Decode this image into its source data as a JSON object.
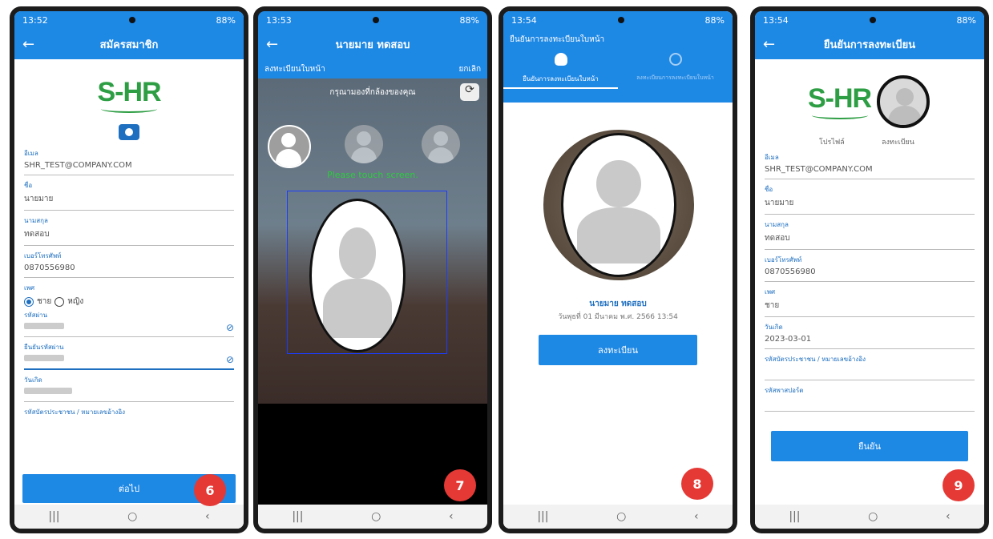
{
  "screens": [
    {
      "status_time": "13:52",
      "status_right": "88%",
      "appbar_title": "สมัครสมาชิก",
      "logo_text": "S-HR",
      "fields": [
        {
          "label": "อีเมล",
          "value": "SHR_TEST@COMPANY.COM"
        },
        {
          "label": "ชื่อ",
          "value": "นายมาย"
        },
        {
          "label": "นามสกุล",
          "value": "ทดสอบ"
        },
        {
          "label": "เบอร์โทรศัพท์",
          "value": "0870556980"
        }
      ],
      "gender_label": "เพศ",
      "gender_options": [
        "ชาย",
        "หญิง"
      ],
      "password_label": "รหัสผ่าน",
      "confirm_password_label": "ยืนยันรหัสผ่าน",
      "birthdate_label": "วันเกิด",
      "id_card_label": "รหัสบัตรประชาชน / หมายเลขอ้างอิง",
      "next_button": "ต่อไป",
      "badge": "6"
    },
    {
      "status_time": "13:53",
      "status_right": "88%",
      "appbar_title": "นายมาย ทดสอบ",
      "subbar_left": "ลงทะเบียนใบหน้า",
      "subbar_right": "ยกเลิก",
      "instruction": "กรุณามองที่กล้องของคุณ",
      "touch_text": "Please touch screen.",
      "badge": "7"
    },
    {
      "status_time": "13:54",
      "status_right": "88%",
      "appbar_title": "ยืนยันการลงทะเบียนใบหน้า",
      "tab_active": "ยืนยันการลงทะเบียนใบหน้า",
      "tab_inactive": "ลงทะเบียนการลงทะเบียนใบหน้า",
      "name": "นายมาย ทดสอบ",
      "date": "วันพุธที่ 01 มีนาคม พ.ศ. 2566 13:54",
      "register_button": "ลงทะเบียน",
      "badge": "8"
    },
    {
      "status_time": "13:54",
      "status_right": "88%",
      "appbar_title": "ยืนยันการลงทะเบียน",
      "logo_text": "S-HR",
      "caption_profile": "โปรไฟล์",
      "caption_register": "ลงทะเบียน",
      "fields": [
        {
          "label": "อีเมล",
          "value": "SHR_TEST@COMPANY.COM"
        },
        {
          "label": "ชื่อ",
          "value": "นายมาย"
        },
        {
          "label": "นามสกุล",
          "value": "ทดสอบ"
        },
        {
          "label": "เบอร์โทรศัพท์",
          "value": "0870556980"
        },
        {
          "label": "เพศ",
          "value": "ชาย"
        },
        {
          "label": "วันเกิด",
          "value": "2023-03-01"
        },
        {
          "label": "รหัสบัตรประชาชน / หมายเลขอ้างอิง",
          "value": ""
        },
        {
          "label": "รหัสพาสปอร์ต",
          "value": ""
        }
      ],
      "confirm_button": "ยืนยัน",
      "badge": "9"
    }
  ],
  "colors": {
    "primary": "#1e88e5",
    "logo_green": "#2e9e44",
    "badge": "#e53935"
  }
}
